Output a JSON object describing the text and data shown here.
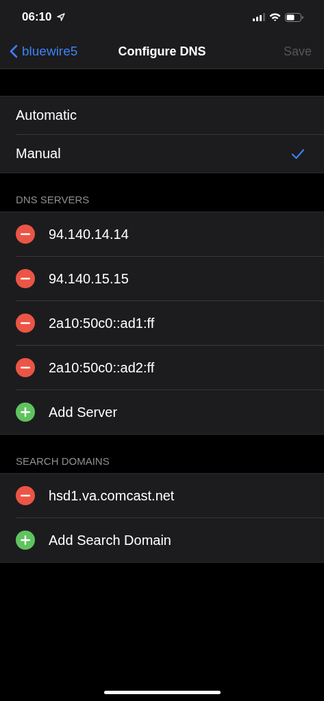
{
  "status_bar": {
    "time": "06:10"
  },
  "nav": {
    "back": "bluewire5",
    "title": "Configure DNS",
    "action": {
      "label": "Save",
      "disabled": true
    }
  },
  "modes": [
    {
      "label": "Automatic",
      "selected": false
    },
    {
      "label": "Manual",
      "selected": true
    }
  ],
  "sections": [
    {
      "header": "DNS SERVERS",
      "rows": [
        {
          "kind": "remove",
          "label": "94.140.14.14"
        },
        {
          "kind": "remove",
          "label": "94.140.15.15"
        },
        {
          "kind": "remove",
          "label": "2a10:50c0::ad1:ff"
        },
        {
          "kind": "remove",
          "label": "2a10:50c0::ad2:ff"
        },
        {
          "kind": "add",
          "label": "Add Server"
        }
      ]
    },
    {
      "header": "SEARCH DOMAINS",
      "rows": [
        {
          "kind": "remove",
          "label": "hsd1.va.comcast.net"
        },
        {
          "kind": "add",
          "label": "Add Search Domain"
        }
      ]
    }
  ]
}
